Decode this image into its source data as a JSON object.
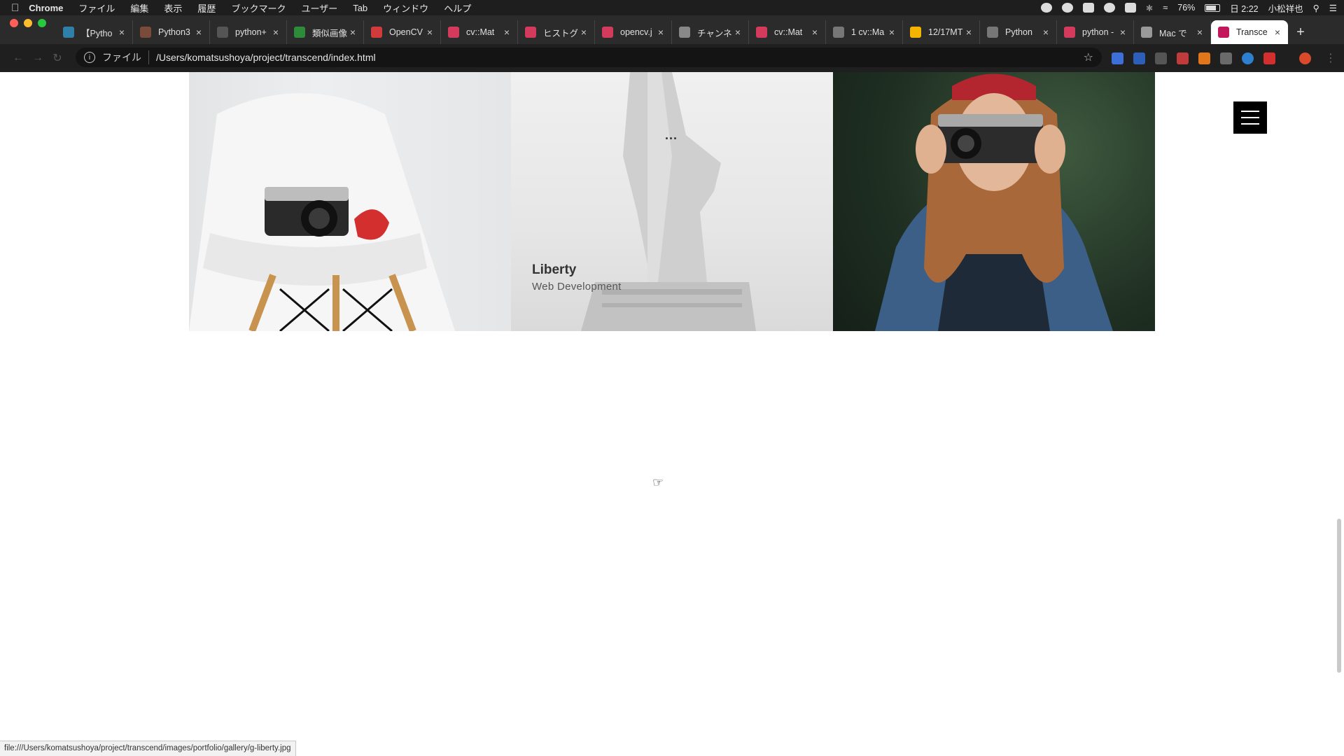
{
  "menubar": {
    "app_name": "Chrome",
    "items": [
      "ファイル",
      "編集",
      "表示",
      "履歴",
      "ブックマーク",
      "ユーザー",
      "Tab",
      "ウィンドウ",
      "ヘルプ"
    ],
    "battery": "76%",
    "clock": "日 2:22",
    "user": "小松祥也"
  },
  "tabs": [
    {
      "title": "【Pytho",
      "favicon": "cg-icon",
      "color": "#2f7fa8"
    },
    {
      "title": "Python3",
      "favicon": "avatar-icon",
      "color": "#7a4a3a"
    },
    {
      "title": "python+",
      "favicon": "info-icon",
      "color": "#555555"
    },
    {
      "title": "類似画像",
      "favicon": "green-icon",
      "color": "#2e8b3a"
    },
    {
      "title": "OpenCV",
      "favicon": "opencv-icon",
      "color": "#d23b3b"
    },
    {
      "title": "cv::Mat",
      "favicon": "hatena-icon",
      "color": "#d43a5b"
    },
    {
      "title": "ヒストグ",
      "favicon": "hatena-icon",
      "color": "#d43a5b"
    },
    {
      "title": "opencv.j",
      "favicon": "hatena-icon",
      "color": "#d43a5b"
    },
    {
      "title": "チャンネ",
      "favicon": "bird-icon",
      "color": "#888888"
    },
    {
      "title": "cv::Mat",
      "favicon": "hatena-icon",
      "color": "#d43a5b"
    },
    {
      "title": "1 cv::Ma",
      "favicon": "globe-icon",
      "color": "#777777"
    },
    {
      "title": "12/17MT",
      "favicon": "slides-icon",
      "color": "#f4b400"
    },
    {
      "title": "Python",
      "favicon": "globe-icon",
      "color": "#777777"
    },
    {
      "title": "python -",
      "favicon": "hatena-icon",
      "color": "#d43a5b"
    },
    {
      "title": "Mac で",
      "favicon": "apple-icon",
      "color": "#999999"
    },
    {
      "title": "Transce",
      "favicon": "t-icon",
      "color": "#c2185b",
      "active": true
    }
  ],
  "omnibox": {
    "scheme_label": "ファイル",
    "url": "/Users/komatsushoya/project/transcend/index.html"
  },
  "gallery": {
    "items": [
      {
        "alt": "camera-on-chair-image"
      },
      {
        "alt": "statue-of-liberty-image",
        "title": "Liberty",
        "category": "Web Development",
        "dots": "..."
      },
      {
        "alt": "woman-with-camera-image"
      }
    ]
  },
  "status_url": "file:///Users/komatsushoya/project/transcend/images/portfolio/gallery/g-liberty.jpg"
}
